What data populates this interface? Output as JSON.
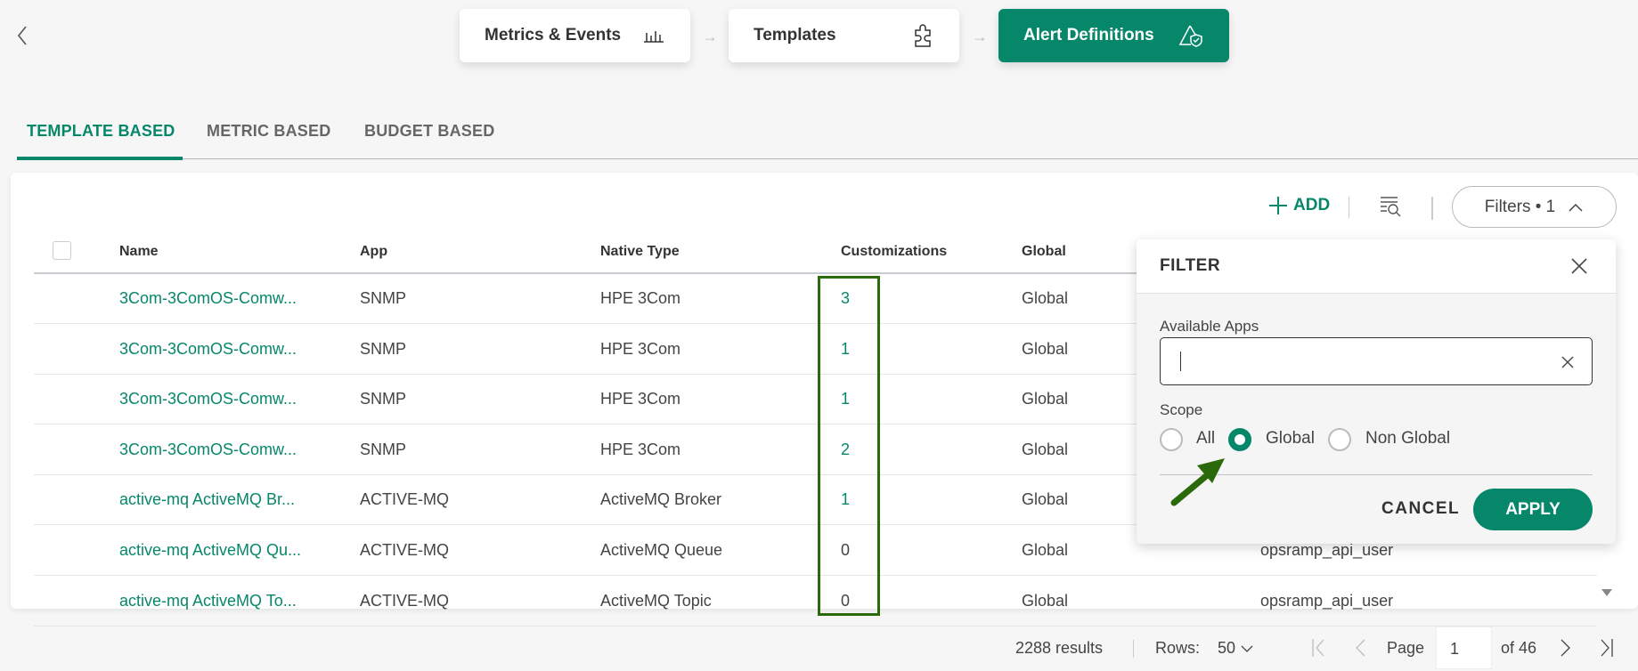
{
  "nav": {
    "back_icon": "chevron-left-icon"
  },
  "steps": [
    {
      "label": "Metrics & Events",
      "icon": "bar-chart-icon"
    },
    {
      "label": "Templates",
      "icon": "puzzle-icon"
    },
    {
      "label": "Alert Definitions",
      "icon": "alert-shield-icon"
    }
  ],
  "tabs": [
    {
      "label": "TEMPLATE BASED"
    },
    {
      "label": "METRIC BASED"
    },
    {
      "label": "BUDGET BASED"
    }
  ],
  "toolbar": {
    "add_label": "ADD",
    "filters_label": "Filters • 1"
  },
  "table": {
    "headers": [
      "Name",
      "App",
      "Native Type",
      "Customizations",
      "Global"
    ],
    "rows": [
      {
        "name": "3Com-3ComOS-Comw...",
        "app": "SNMP",
        "type": "HPE 3Com",
        "cust": "3",
        "global": "Global",
        "owner": ""
      },
      {
        "name": "3Com-3ComOS-Comw...",
        "app": "SNMP",
        "type": "HPE 3Com",
        "cust": "1",
        "global": "Global",
        "owner": ""
      },
      {
        "name": "3Com-3ComOS-Comw...",
        "app": "SNMP",
        "type": "HPE 3Com",
        "cust": "1",
        "global": "Global",
        "owner": ""
      },
      {
        "name": "3Com-3ComOS-Comw...",
        "app": "SNMP",
        "type": "HPE 3Com",
        "cust": "2",
        "global": "Global",
        "owner": ""
      },
      {
        "name": "active-mq ActiveMQ Br...",
        "app": "ACTIVE-MQ",
        "type": "ActiveMQ Broker",
        "cust": "1",
        "global": "Global",
        "owner": ""
      },
      {
        "name": "active-mq ActiveMQ Qu...",
        "app": "ACTIVE-MQ",
        "type": "ActiveMQ Queue",
        "cust": "0",
        "global": "Global",
        "owner": "opsramp_api_user"
      },
      {
        "name": "active-mq ActiveMQ To...",
        "app": "ACTIVE-MQ",
        "type": "ActiveMQ Topic",
        "cust": "0",
        "global": "Global",
        "owner": "opsramp_api_user"
      }
    ]
  },
  "filter": {
    "title": "FILTER",
    "apps_label": "Available Apps",
    "apps_value": "",
    "scope_label": "Scope",
    "scope_options": [
      "All",
      "Global",
      "Non Global"
    ],
    "scope_selected": "Global",
    "cancel": "CANCEL",
    "apply": "APPLY"
  },
  "footer": {
    "results": "2288 results",
    "rows_label": "Rows:",
    "rows_value": "50",
    "page_label": "Page",
    "page_value": "1",
    "of_pages": "of 46"
  },
  "colors": {
    "accent": "#07876a",
    "highlight": "#2a6a0a"
  }
}
